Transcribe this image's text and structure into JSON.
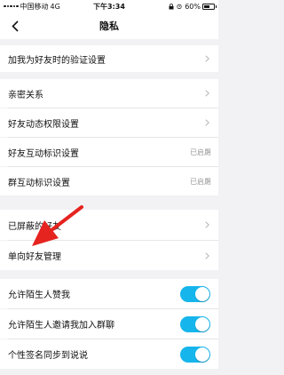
{
  "status_bar": {
    "carrier": "中国移动",
    "network": "4G",
    "time": "下午3:34",
    "battery": "60%",
    "battery_level": 0.6
  },
  "nav": {
    "title": "隐私",
    "back_icon": "chevron-left-icon"
  },
  "sections": {
    "verify": {
      "label": "加我为好友时的验证设置"
    },
    "intimate": {
      "label": "亲密关系"
    },
    "feed_permission": {
      "label": "好友动态权限设置"
    },
    "friend_mark": {
      "label": "好友互动标识设置",
      "status": "已启用"
    },
    "group_mark": {
      "label": "群互动标识设置",
      "status": "已启用"
    },
    "blocked": {
      "label": "已屏蔽的好友"
    },
    "one_way": {
      "label": "单向好友管理"
    },
    "allow_like": {
      "label": "允许陌生人赞我",
      "on": true
    },
    "allow_invite": {
      "label": "允许陌生人邀请我加入群聊",
      "on": true
    },
    "sync_signature": {
      "label": "个性签名同步到说说",
      "on": true
    }
  },
  "colors": {
    "toggle_on": "#16b5ec",
    "annotation_arrow": "#e5231f"
  }
}
